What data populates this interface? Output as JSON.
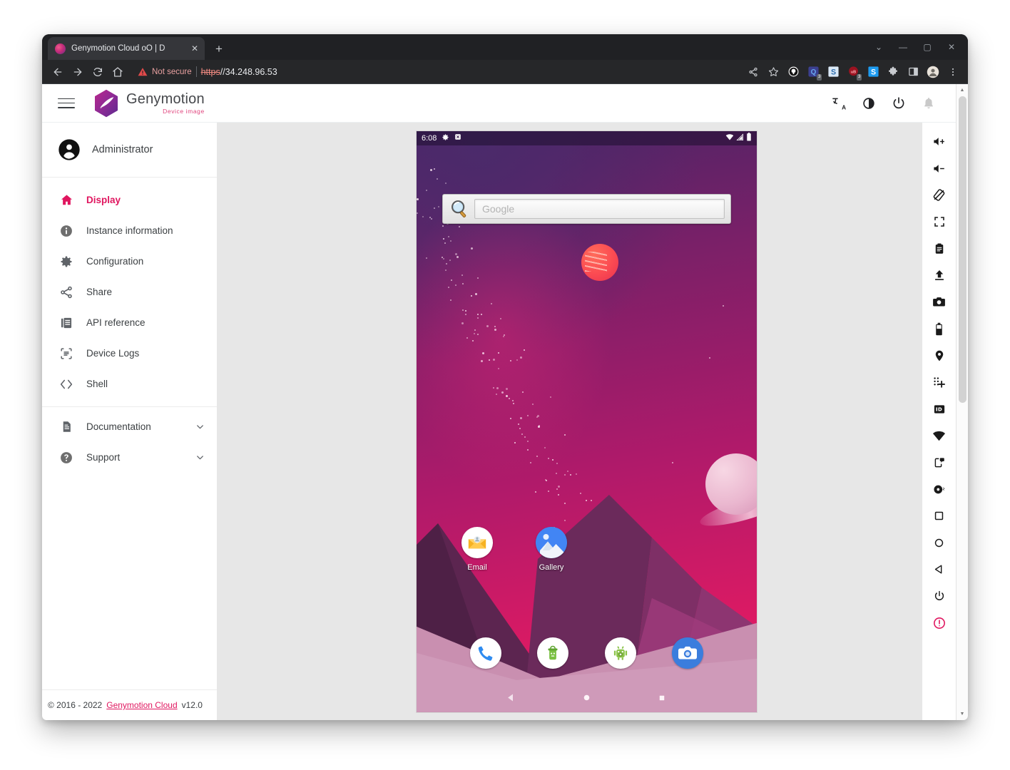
{
  "browser": {
    "tab": {
      "title": "Genymotion Cloud oO | D",
      "favicon": "genymotion-favicon",
      "close_label": "✕"
    },
    "new_tab_label": "+",
    "window_controls": [
      {
        "name": "browser-menu-chevron",
        "glyph": "⌄"
      },
      {
        "name": "minimize-button",
        "glyph": "—"
      },
      {
        "name": "maximize-button",
        "glyph": "▢"
      },
      {
        "name": "close-window-button",
        "glyph": "✕"
      }
    ],
    "nav": {
      "back_label": "←",
      "forward_label": "→",
      "reload_label": "⟳",
      "home_label": "⌂"
    },
    "address": {
      "security_label": "Not secure",
      "scheme": "https",
      "rest": "//34.248.96.53"
    },
    "toolbar_icons": [
      {
        "name": "share-icon",
        "badge": ""
      },
      {
        "name": "bookmark-star-icon",
        "badge": ""
      },
      {
        "name": "extension-keepass-icon",
        "badge": ""
      },
      {
        "name": "extension-q-icon",
        "badge": "3"
      },
      {
        "name": "extension-s-blue-icon",
        "badge": ""
      },
      {
        "name": "extension-ub-red-icon",
        "badge": "3"
      },
      {
        "name": "extension-s-cyan-icon",
        "badge": ""
      },
      {
        "name": "extensions-puzzle-icon",
        "badge": ""
      },
      {
        "name": "side-panel-icon",
        "badge": ""
      },
      {
        "name": "profile-avatar-icon",
        "badge": ""
      },
      {
        "name": "chrome-menu-icon",
        "badge": ""
      }
    ]
  },
  "app": {
    "brand": {
      "name": "Genymotion",
      "tagline": "Device image"
    },
    "header_actions": [
      {
        "name": "translate-icon",
        "label": "Translate"
      },
      {
        "name": "brightness-icon",
        "label": "Theme"
      },
      {
        "name": "power-icon",
        "label": "Power"
      },
      {
        "name": "notifications-bell-icon",
        "label": "Notifications"
      }
    ]
  },
  "sidebar": {
    "user": {
      "name": "Administrator"
    },
    "items": [
      {
        "label": "Display",
        "icon": "home-icon",
        "active": true
      },
      {
        "label": "Instance information",
        "icon": "info-icon",
        "active": false
      },
      {
        "label": "Configuration",
        "icon": "gear-icon",
        "active": false
      },
      {
        "label": "Share",
        "icon": "share-icon",
        "active": false
      },
      {
        "label": "API reference",
        "icon": "book-icon",
        "active": false
      },
      {
        "label": "Device Logs",
        "icon": "device-logs-icon",
        "active": false
      },
      {
        "label": "Shell",
        "icon": "code-brackets-icon",
        "active": false
      }
    ],
    "groups": [
      {
        "label": "Documentation",
        "icon": "document-icon",
        "chevron": "⌄"
      },
      {
        "label": "Support",
        "icon": "help-circle-icon",
        "chevron": "⌄"
      }
    ],
    "footer": {
      "copyright": "© 2016 - 2022",
      "link": "Genymotion Cloud",
      "version": "v12.0"
    }
  },
  "device_rail": [
    {
      "name": "volume-up-icon",
      "label": "Volume up"
    },
    {
      "name": "volume-down-icon",
      "label": "Volume down"
    },
    {
      "name": "rotate-icon",
      "label": "Rotate"
    },
    {
      "name": "fullscreen-icon",
      "label": "Fullscreen"
    },
    {
      "name": "clipboard-icon",
      "label": "Clipboard"
    },
    {
      "name": "upload-icon",
      "label": "Upload"
    },
    {
      "name": "screenshot-camera-icon",
      "label": "Screenshot"
    },
    {
      "name": "battery-icon",
      "label": "Battery"
    },
    {
      "name": "gps-location-icon",
      "label": "GPS"
    },
    {
      "name": "multitouch-icon",
      "label": "Multi-touch"
    },
    {
      "name": "identifiers-id-icon",
      "label": "Identifiers"
    },
    {
      "name": "network-wifi-icon",
      "label": "Network"
    },
    {
      "name": "phone-sms-icon",
      "label": "Phone & SMS"
    },
    {
      "name": "disk-io-icon",
      "label": "Disk I/O"
    },
    {
      "name": "recents-square-icon",
      "label": "Recents"
    },
    {
      "name": "home-circle-icon",
      "label": "Home"
    },
    {
      "name": "back-triangle-icon",
      "label": "Back"
    },
    {
      "name": "power-button-icon",
      "label": "Power"
    },
    {
      "name": "alert-exclamation-icon",
      "label": "Alert"
    }
  ],
  "device": {
    "statusbar": {
      "time": "6:08",
      "left_icons": [
        {
          "name": "settings-status-icon"
        },
        {
          "name": "adb-status-icon"
        }
      ],
      "right_icons": [
        {
          "name": "wifi-status-icon"
        },
        {
          "name": "signal-status-icon"
        },
        {
          "name": "battery-status-icon"
        }
      ]
    },
    "search_widget": {
      "icon": "google-magnifier-icon",
      "placeholder": "Google"
    },
    "home_apps": [
      {
        "label": "Email",
        "icon": "email-app-icon"
      },
      {
        "label": "Gallery",
        "icon": "gallery-app-icon"
      }
    ],
    "dock_apps": [
      {
        "label": "Phone",
        "icon": "phone-app-icon"
      },
      {
        "label": "Market",
        "icon": "market-app-icon"
      },
      {
        "label": "Settings",
        "icon": "android-settings-app-icon"
      },
      {
        "label": "Camera",
        "icon": "camera-app-icon"
      }
    ],
    "navbar": [
      {
        "name": "android-back-button",
        "glyph": "◀"
      },
      {
        "name": "android-home-button",
        "glyph": "●"
      },
      {
        "name": "android-recents-button",
        "glyph": "■"
      }
    ]
  },
  "scrollbar": {
    "up": "▲",
    "down": "▼"
  },
  "colors": {
    "accent": "#e0165f",
    "browser_chrome": "#202124",
    "stage": "#e7e7e7",
    "not_secure": "#e8a0a0"
  }
}
